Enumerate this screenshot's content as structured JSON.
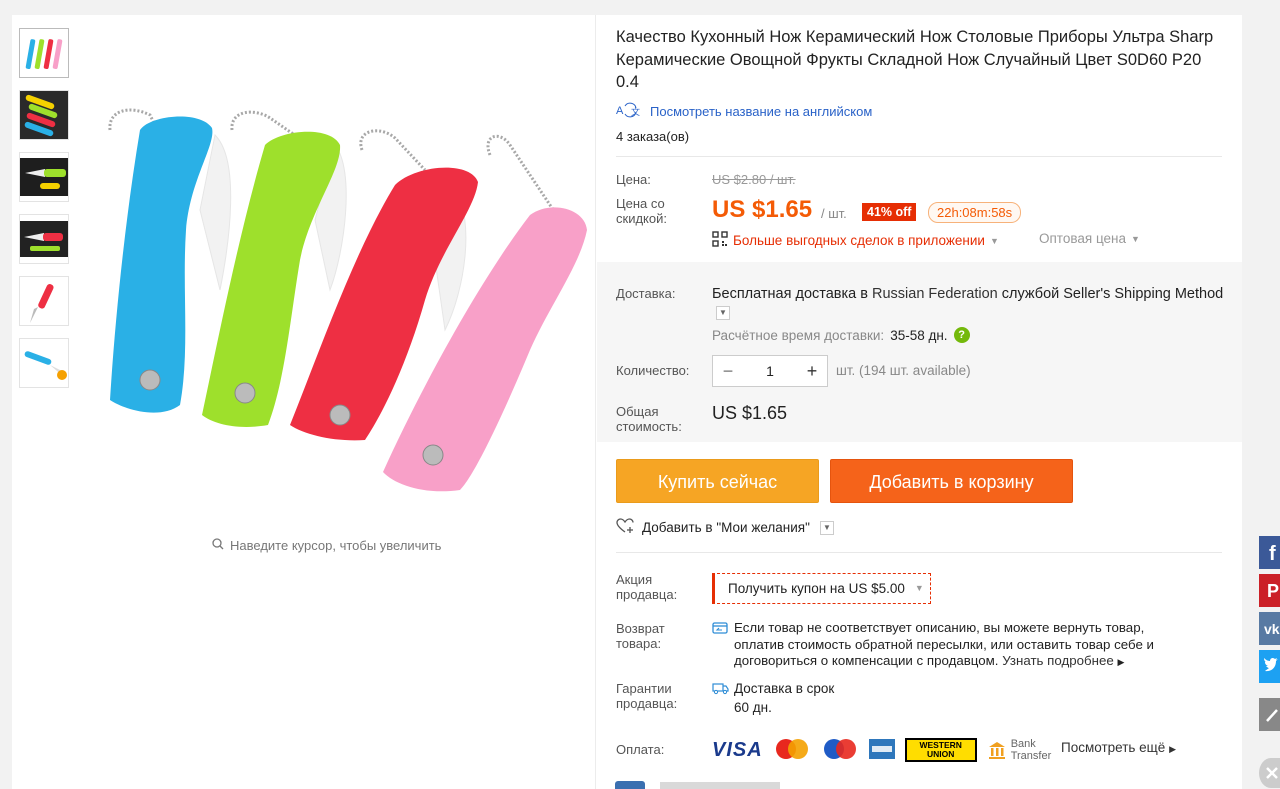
{
  "product": {
    "title": "Качество Кухонный Нож Керамический Нож Столовые Приборы Ультра Sharp Керамические Овощной Фрукты Складной Нож Случайный Цвет S0D60 P20 0.4",
    "translate_link": "Посмотреть название на английском",
    "orders": "4 заказа(ов)",
    "zoom_hint": "Наведите курсор, чтобы увеличить",
    "knife_colors": [
      "#2ab0e6",
      "#9ee02c",
      "#ee2f43",
      "#f8a0c8"
    ]
  },
  "pricing": {
    "price_label": "Цена:",
    "old_price": "US $2.80 / шт.",
    "discount_label": "Цена со скидкой:",
    "price": "US $1.65",
    "per_unit": "/ шт.",
    "discount_badge": "41% off",
    "timer": "22h:08m:58s",
    "app_deals": "Больше выгодных сделок в приложении",
    "wholesale": "Оптовая цена"
  },
  "shipping": {
    "label": "Доставка:",
    "text_prefix": "Бесплатная доставка в",
    "country": "Russian Federation",
    "text_suffix": "службой Seller's Shipping Method",
    "est_label": "Расчётное время доставки:",
    "est_value": "35-58 дн.",
    "help": "?"
  },
  "quantity": {
    "label": "Количество:",
    "minus": "−",
    "value": "1",
    "plus": "+",
    "available": "шт. (194 шт. available)"
  },
  "total": {
    "label": "Общая стоимость:",
    "value": "US $1.65"
  },
  "actions": {
    "buy_now": "Купить сейчас",
    "add_to_cart": "Добавить в корзину",
    "wishlist": "Добавить в \"Мои желания\""
  },
  "seller_promo": {
    "label": "Акция продавца:",
    "coupon": "Получить купон на US $5.00"
  },
  "returns": {
    "label": "Возврат товара:",
    "text": "Если товар не соответствует описанию, вы можете вернуть товар, оплатив стоимость обратной пересылки, или оставить товар себе и договориться о компенсации с продавцом.",
    "more": "Узнать подробнее"
  },
  "guarantee": {
    "label": "Гарантии продавца:",
    "line1": "Доставка в срок",
    "line2": "60 дн."
  },
  "payment": {
    "label": "Оплата:",
    "methods": [
      "VISA",
      "MasterCard",
      "Maestro",
      "AMEX",
      "WESTERN UNION",
      "Bank Transfer"
    ],
    "see_more": "Посмотреть ещё"
  },
  "social": [
    "facebook",
    "pinterest",
    "vk",
    "twitter",
    "edit",
    "close"
  ],
  "colors": {
    "accent": "#f45b06",
    "sale_red": "#e62e04",
    "link_blue": "#2962c8",
    "buy_orange": "#f6a524",
    "cart_orange": "#f5631a"
  }
}
